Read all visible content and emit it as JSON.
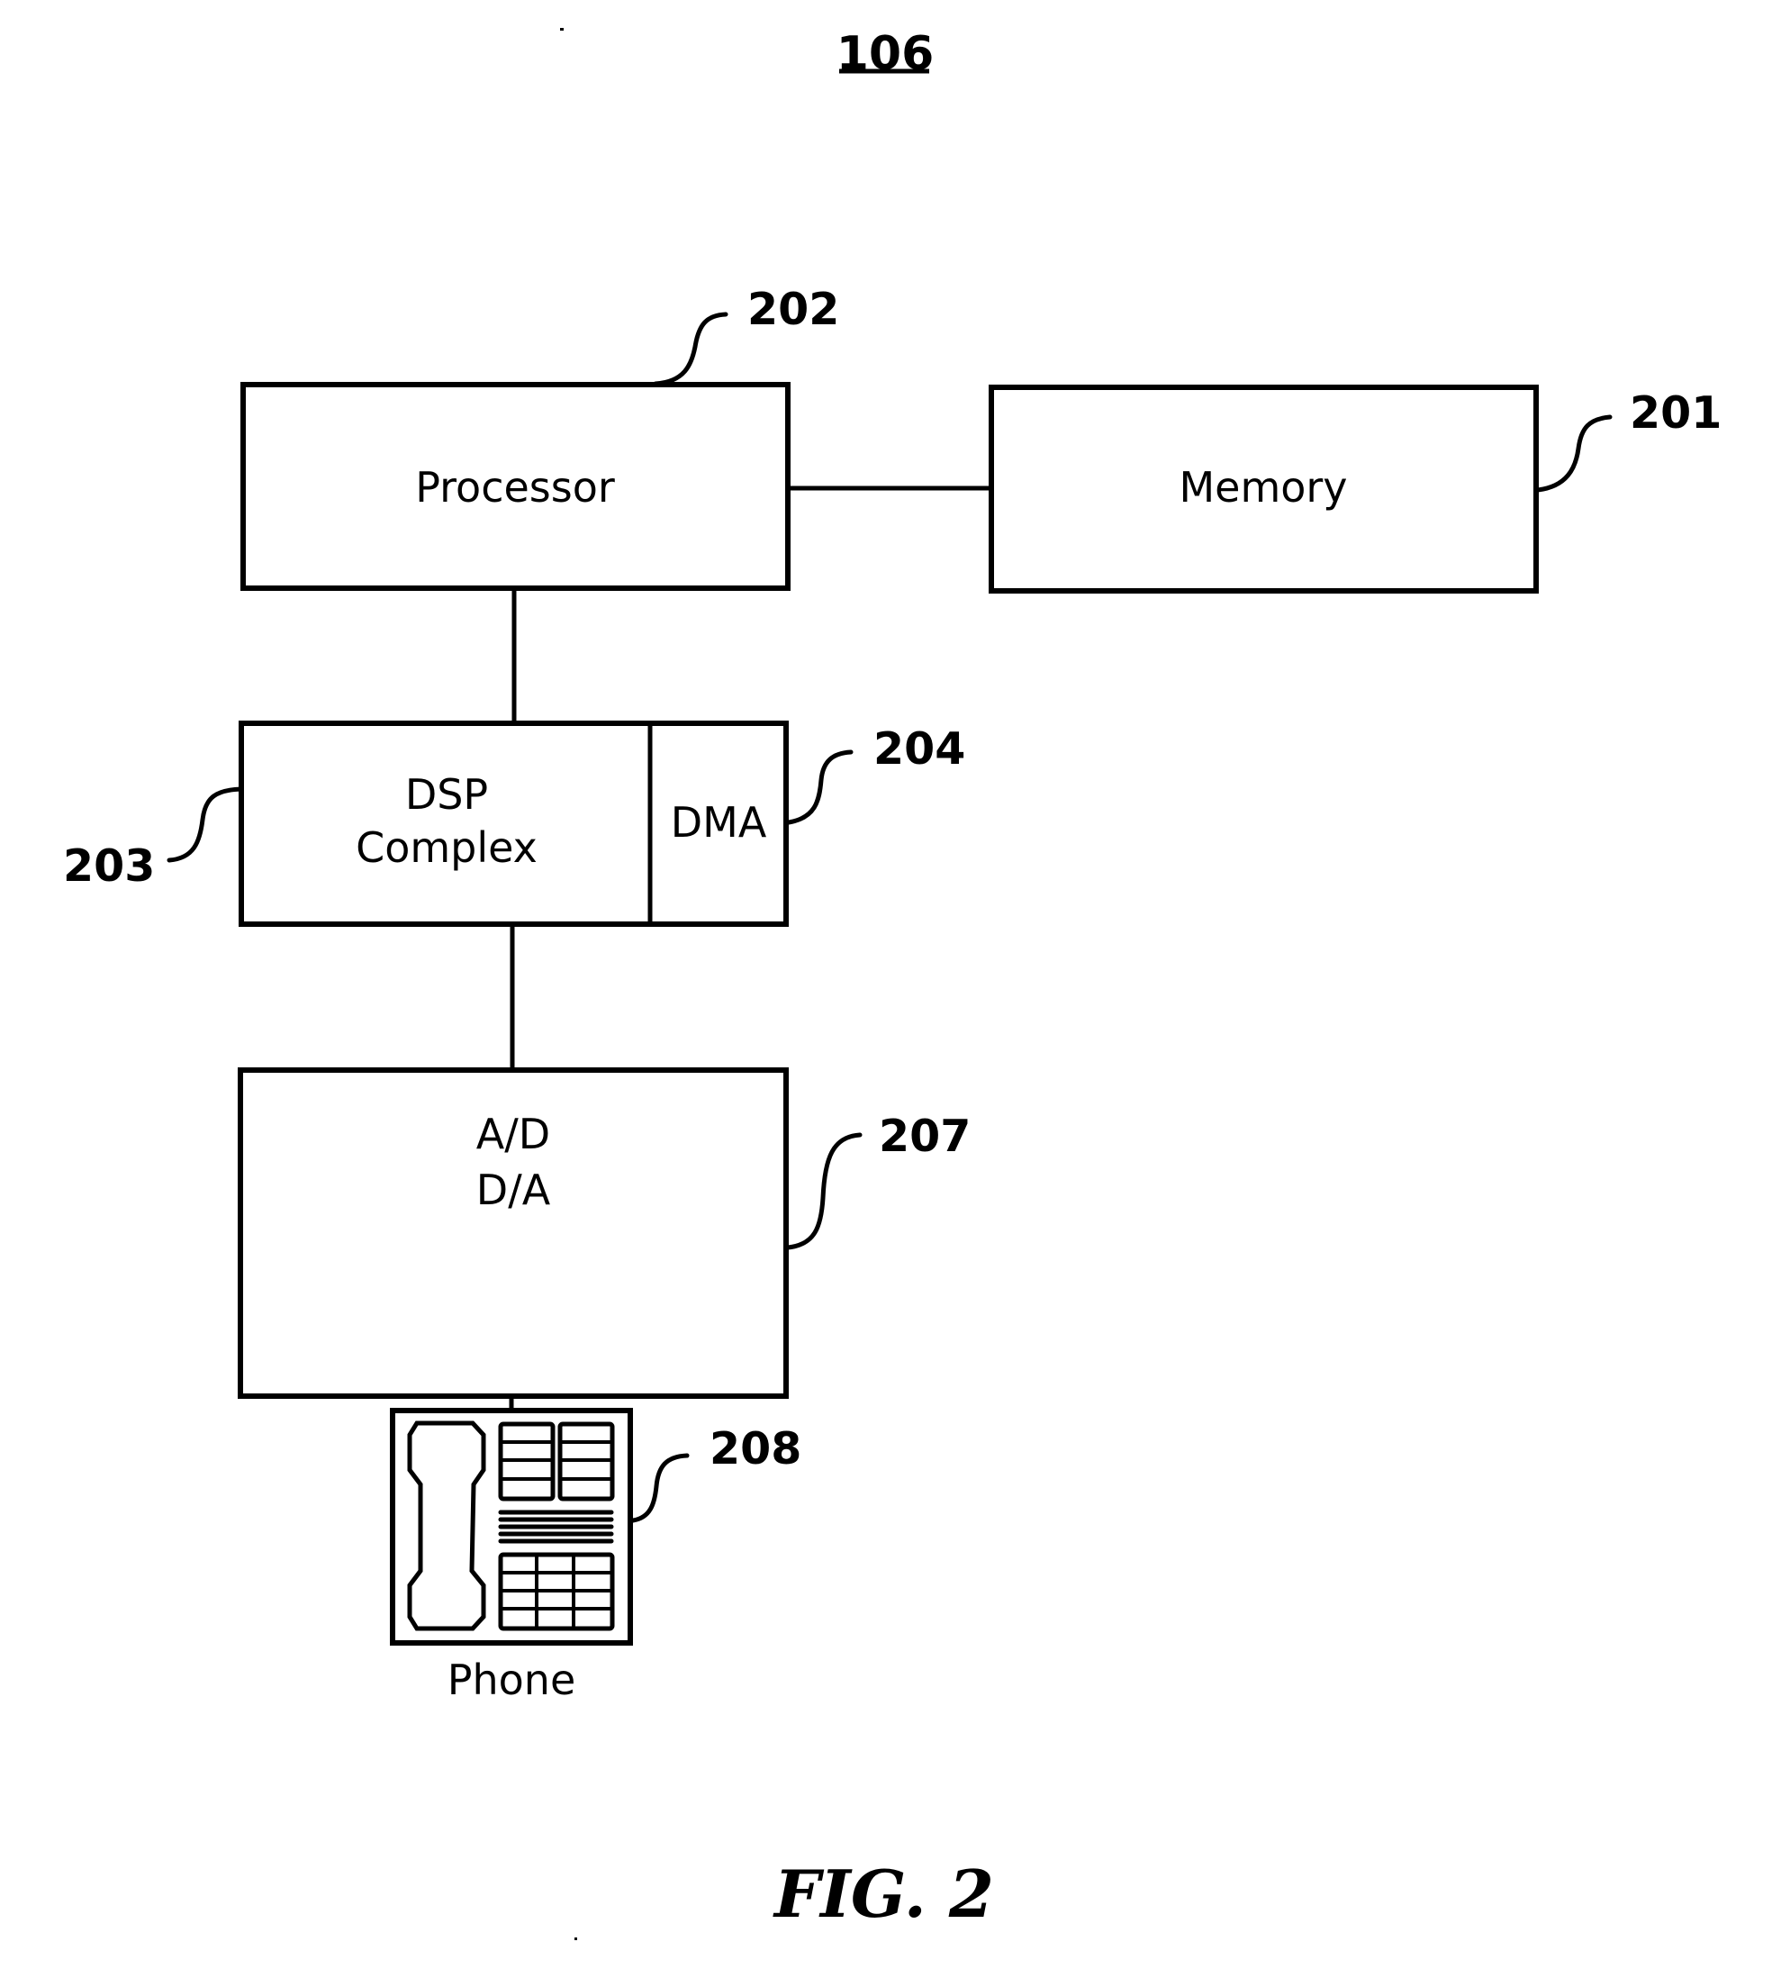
{
  "figure": {
    "number_label": "106",
    "caption": "FIG. 2"
  },
  "blocks": {
    "processor": {
      "label": "Processor",
      "ref": "202"
    },
    "memory": {
      "label": "Memory",
      "ref": "201"
    },
    "dsp_complex": {
      "label_line1": "DSP",
      "label_line2": "Complex",
      "ref": "203"
    },
    "dma": {
      "label": "DMA",
      "ref": "204"
    },
    "converter": {
      "label_line1": "A/D",
      "label_line2": "D/A",
      "ref": "207"
    },
    "phone": {
      "label": "Phone",
      "ref": "208",
      "icon": "desk-phone-icon"
    }
  },
  "connections": [
    {
      "from": "processor",
      "to": "memory"
    },
    {
      "from": "processor",
      "to": "dsp_complex"
    },
    {
      "from": "dsp_complex",
      "to": "converter"
    },
    {
      "from": "converter",
      "to": "phone"
    }
  ]
}
